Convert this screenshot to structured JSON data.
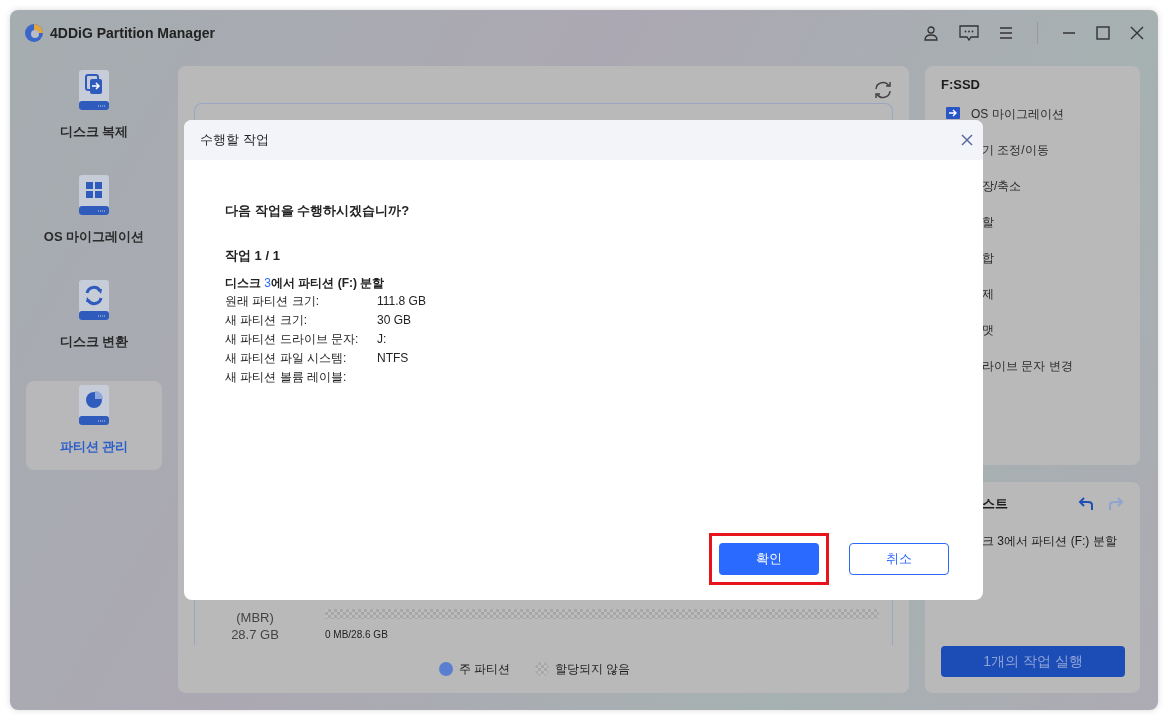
{
  "app": {
    "title": "4DDiG Partition Manager"
  },
  "sidebar": {
    "items": [
      {
        "label": "디스크 복제",
        "selected": false
      },
      {
        "label": "OS 마이그레이션",
        "selected": false
      },
      {
        "label": "디스크 변환",
        "selected": false
      },
      {
        "label": "파티션 관리",
        "selected": true
      }
    ]
  },
  "disk": {
    "style": "(MBR)",
    "size": "28.7 GB",
    "usage": "0 MB/28.6 GB"
  },
  "legend": [
    {
      "label": "주 파티션",
      "kind": "primary"
    },
    {
      "label": "할당되지 않음",
      "kind": "unallocated"
    }
  ],
  "dialog": {
    "title": "수행할 작업",
    "question": "다음 작업을 수행하시겠습니까?",
    "progress": "작업 1 / 1",
    "operation": {
      "before": "디스크 ",
      "highlight": "3",
      "after": "에서 파티션 (F:) 분할"
    },
    "details": [
      {
        "label": "원래 파티션 크기:",
        "value": "111.8 GB"
      },
      {
        "label": "새 파티션 크기:",
        "value": "30 GB"
      },
      {
        "label": "새 파티션 드라이브 문자:",
        "value": "J:"
      },
      {
        "label": "새 파티션 파일 시스템:",
        "value": "NTFS"
      },
      {
        "label": "새 파티션 볼륨 레이블:"
      }
    ],
    "buttons": [
      {
        "label": "확인",
        "kind": "primary",
        "highlighted": true
      },
      {
        "label": "취소",
        "kind": "secondary",
        "highlighted": false
      }
    ]
  },
  "properties_panel": {
    "title": "F:SSD",
    "items": [
      {
        "label": "OS 마이그레이션",
        "kind": "full"
      },
      {
        "label": "기 조정/이동",
        "kind": "clipped"
      },
      {
        "label": "장/축소",
        "kind": "clipped"
      },
      {
        "label": "할",
        "kind": "clipped"
      },
      {
        "label": "합",
        "kind": "clipped"
      },
      {
        "label": "제",
        "kind": "clipped"
      },
      {
        "label": "맷",
        "kind": "clipped"
      },
      {
        "label": "라이브 문자 변경",
        "kind": "clipped"
      }
    ]
  },
  "pending_panel": {
    "title": "스트",
    "undo": {
      "disabled": false
    },
    "redo": {
      "disabled": true
    },
    "items": [
      "크 3에서 파티션 (F:) 분할"
    ],
    "run_button": "1개의 작업 실행"
  }
}
